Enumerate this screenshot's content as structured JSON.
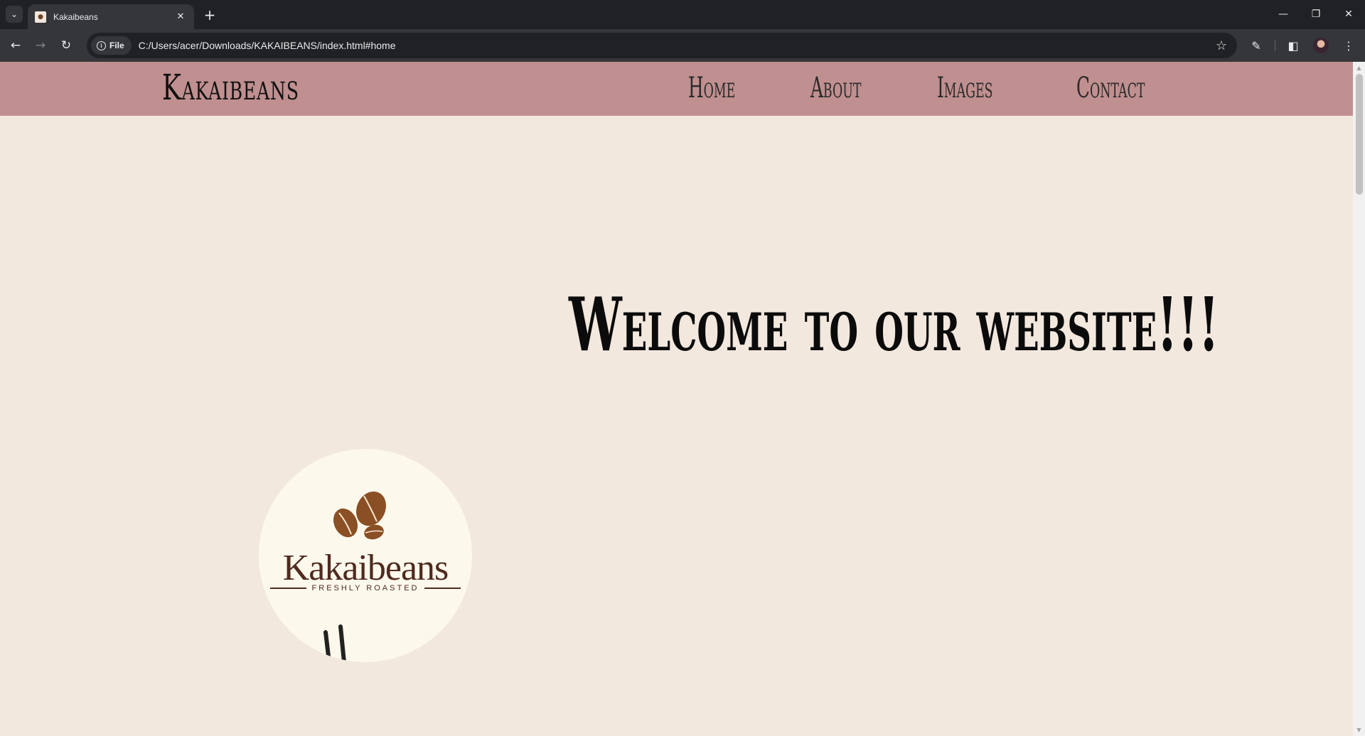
{
  "browser": {
    "tab": {
      "title": "Kakaibeans"
    },
    "toolbar": {
      "site_chip": "File",
      "url": "C:/Users/acer/Downloads/KAKAIBEANS/index.html#home"
    }
  },
  "page": {
    "brand": "Kakaibeans",
    "nav": [
      {
        "label": "Home"
      },
      {
        "label": "About"
      },
      {
        "label": "Images"
      },
      {
        "label": "Contact"
      }
    ],
    "hero_title": "Welcome to our website!!!",
    "logo": {
      "name": "Kakaibeans",
      "tagline": "FRESHLY ROASTED"
    }
  },
  "colors": {
    "header_bg": "#c08f8f",
    "page_bg": "#f3e8de",
    "logo_bg": "#fdf8ec",
    "logo_text": "#4f2a1f",
    "bean": "#8a4f24"
  },
  "icons": [
    "tab-search-icon",
    "close-icon",
    "plus-icon",
    "minimize-icon",
    "restore-icon",
    "back-icon",
    "forward-icon",
    "reload-icon",
    "info-icon",
    "star-icon",
    "extensions-icon",
    "side-panel-icon",
    "menu-icon",
    "coffee-bean-icon"
  ]
}
